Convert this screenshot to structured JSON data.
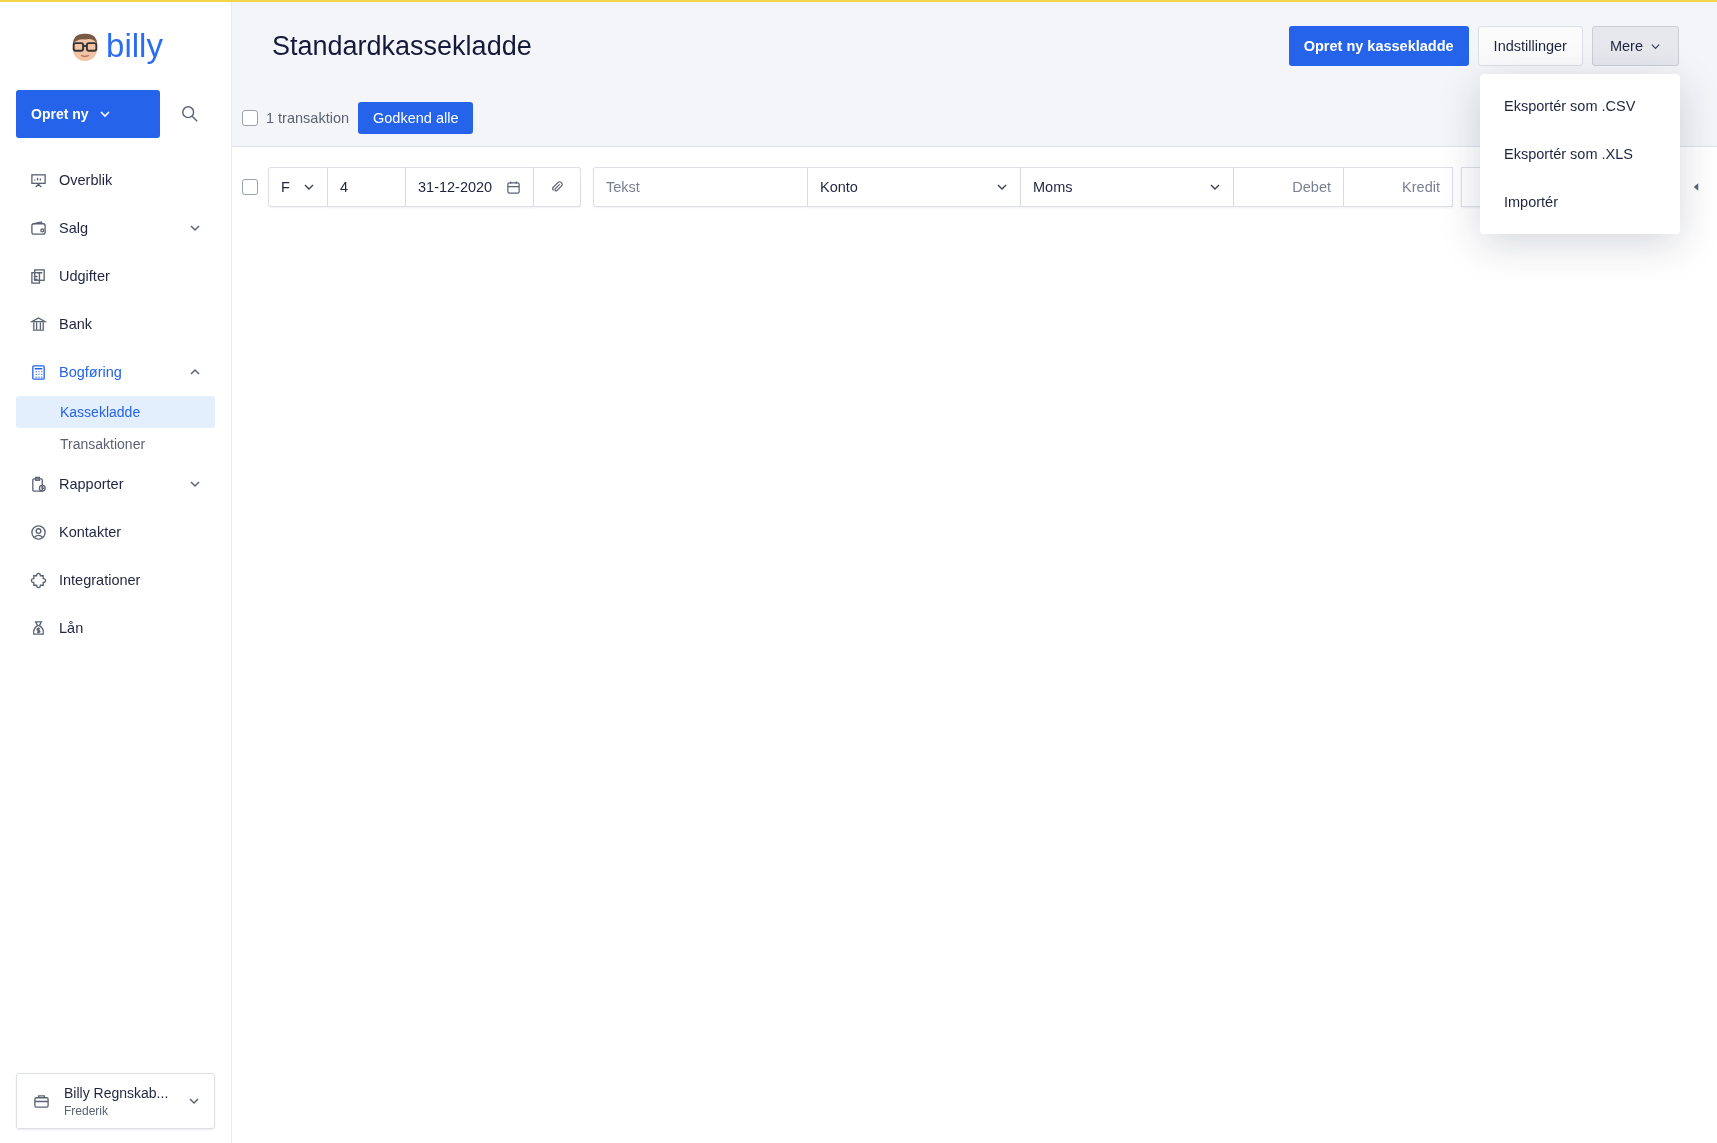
{
  "sidebar": {
    "logo": "billy",
    "create_button": "Opret ny",
    "nav": [
      {
        "label": "Overblik",
        "selected": false
      },
      {
        "label": "Salg",
        "expanded": false,
        "selected": false
      },
      {
        "label": "Udgifter",
        "selected": false
      },
      {
        "label": "Bank",
        "selected": false
      },
      {
        "label": "Bogføring",
        "expanded": true,
        "selected": true,
        "children": [
          {
            "label": "Kassekladde",
            "selected": true
          },
          {
            "label": "Transaktioner",
            "selected": false
          }
        ]
      },
      {
        "label": "Rapporter",
        "expanded": false,
        "selected": false
      },
      {
        "label": "Kontakter",
        "selected": false
      },
      {
        "label": "Integrationer",
        "selected": false
      },
      {
        "label": "Lån",
        "selected": false
      }
    ],
    "org": {
      "name": "Billy Regnskab...",
      "user": "Frederik"
    }
  },
  "header": {
    "title": "Standardkassekladde",
    "buttons": [
      {
        "label": "Opret ny kassekladde",
        "kind": "primary"
      },
      {
        "label": "Indstillinger",
        "kind": "secondary"
      },
      {
        "label": "Mere",
        "kind": "menu"
      }
    ],
    "menu": [
      {
        "label": "Eksportér som .CSV"
      },
      {
        "label": "Eksportér som .XLS"
      },
      {
        "label": "Importér"
      }
    ]
  },
  "toolbar": {
    "select_all_checked": false,
    "count": "1 transaktion",
    "approve_button": "Godkend alle"
  },
  "row": {
    "checked": false,
    "fields": [
      {
        "kind": "select",
        "value": "F"
      },
      {
        "kind": "input",
        "value": "4"
      },
      {
        "kind": "date",
        "value": "31-12-2020"
      },
      {
        "kind": "attach"
      },
      {
        "kind": "input",
        "placeholder": "Tekst"
      },
      {
        "kind": "select",
        "value": "Konto"
      },
      {
        "kind": "select",
        "value": "Moms"
      },
      {
        "kind": "amount",
        "placeholder": "Debet"
      },
      {
        "kind": "amount",
        "placeholder": "Kredit"
      },
      {
        "kind": "blank"
      }
    ]
  }
}
